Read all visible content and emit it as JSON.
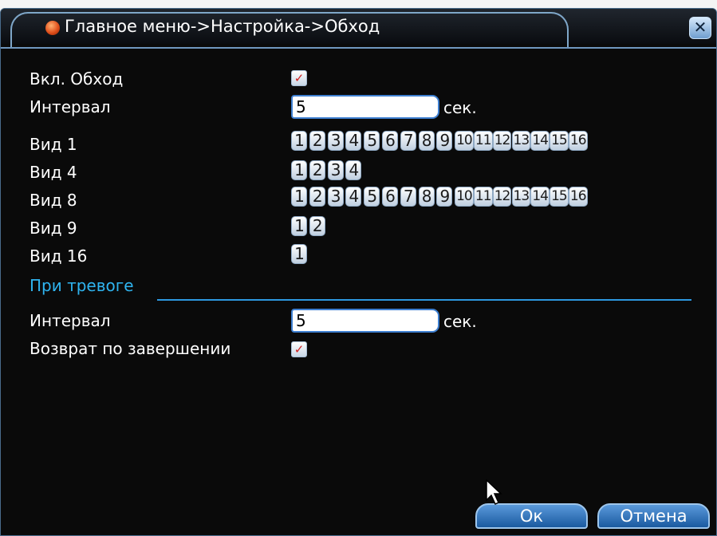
{
  "window": {
    "title": "Главное меню->Настройка->Обход",
    "close_label": "✕"
  },
  "tour_enable": {
    "label": "Вкл. Обход",
    "checked": true
  },
  "interval": {
    "label": "Интервал",
    "value": "5",
    "unit": "сек."
  },
  "views": [
    {
      "label": "Вид 1",
      "channels": [
        "1",
        "2",
        "3",
        "4",
        "5",
        "6",
        "7",
        "8",
        "9",
        "10",
        "11",
        "12",
        "13",
        "14",
        "15",
        "16"
      ]
    },
    {
      "label": "Вид 4",
      "channels": [
        "1",
        "2",
        "3",
        "4"
      ]
    },
    {
      "label": "Вид 8",
      "channels": [
        "1",
        "2",
        "3",
        "4",
        "5",
        "6",
        "7",
        "8",
        "9",
        "10",
        "11",
        "12",
        "13",
        "14",
        "15",
        "16"
      ]
    },
    {
      "label": "Вид 9",
      "channels": [
        "1",
        "2"
      ]
    },
    {
      "label": "Вид 16",
      "channels": [
        "1"
      ]
    }
  ],
  "alarm": {
    "section_title": "При тревоге",
    "interval_label": "Интервал",
    "interval_value": "5",
    "interval_unit": "сек.",
    "return_label": "Возврат по завершении",
    "return_checked": true
  },
  "buttons": {
    "ok": "Ок",
    "cancel": "Отмена"
  },
  "icons": {
    "title": "menu-orb-icon",
    "close": "close-icon",
    "check": "checkmark-icon",
    "cursor": "mouse-pointer-icon"
  },
  "colors": {
    "accent": "#2fb4f0",
    "frame": "#6f97bf",
    "check": "#d02020",
    "button": "#3a7cc4"
  }
}
